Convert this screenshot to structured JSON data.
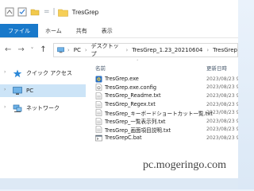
{
  "window": {
    "title": "TresGrep"
  },
  "ribbon": {
    "tabs": [
      "ファイル",
      "ホーム",
      "共有",
      "表示"
    ]
  },
  "address": {
    "crumbs": [
      "PC",
      "デスクトップ",
      "TresGrep_1.23_20210604",
      "TresGrep"
    ]
  },
  "sidebar": {
    "items": [
      {
        "label": "クイック アクセス",
        "icon": "star-icon"
      },
      {
        "label": "PC",
        "icon": "pc-icon",
        "selected": true
      },
      {
        "label": "ネットワーク",
        "icon": "network-icon"
      }
    ]
  },
  "list": {
    "col_name": "名前",
    "col_date": "更新日時",
    "files": [
      {
        "name": "TresGrep.exe",
        "date": "2023/08/23 9:...",
        "icon": "exe-icon"
      },
      {
        "name": "TresGrep.exe.config",
        "date": "2023/08/23 9:...",
        "icon": "config-icon"
      },
      {
        "name": "TresGrep_Readme.txt",
        "date": "2023/08/23 9:...",
        "icon": "text-file-icon"
      },
      {
        "name": "TresGrep_Regex.txt",
        "date": "2023/08/23 9:...",
        "icon": "text-file-icon"
      },
      {
        "name": "TresGrep_キーボードショートカット一覧.txt",
        "date": "2023/08/23 9:...",
        "icon": "text-file-icon"
      },
      {
        "name": "TresGrep_一覧表示列.txt",
        "date": "2023/08/23 9:...",
        "icon": "text-file-icon"
      },
      {
        "name": "TresGrep_画面項目説明.txt",
        "date": "2023/08/23 9:...",
        "icon": "text-file-icon"
      },
      {
        "name": "TresGrepC.bat",
        "date": "2023/08/23 9:...",
        "icon": "batch-file-icon"
      }
    ]
  },
  "watermark": "pc.mogeringo.com"
}
